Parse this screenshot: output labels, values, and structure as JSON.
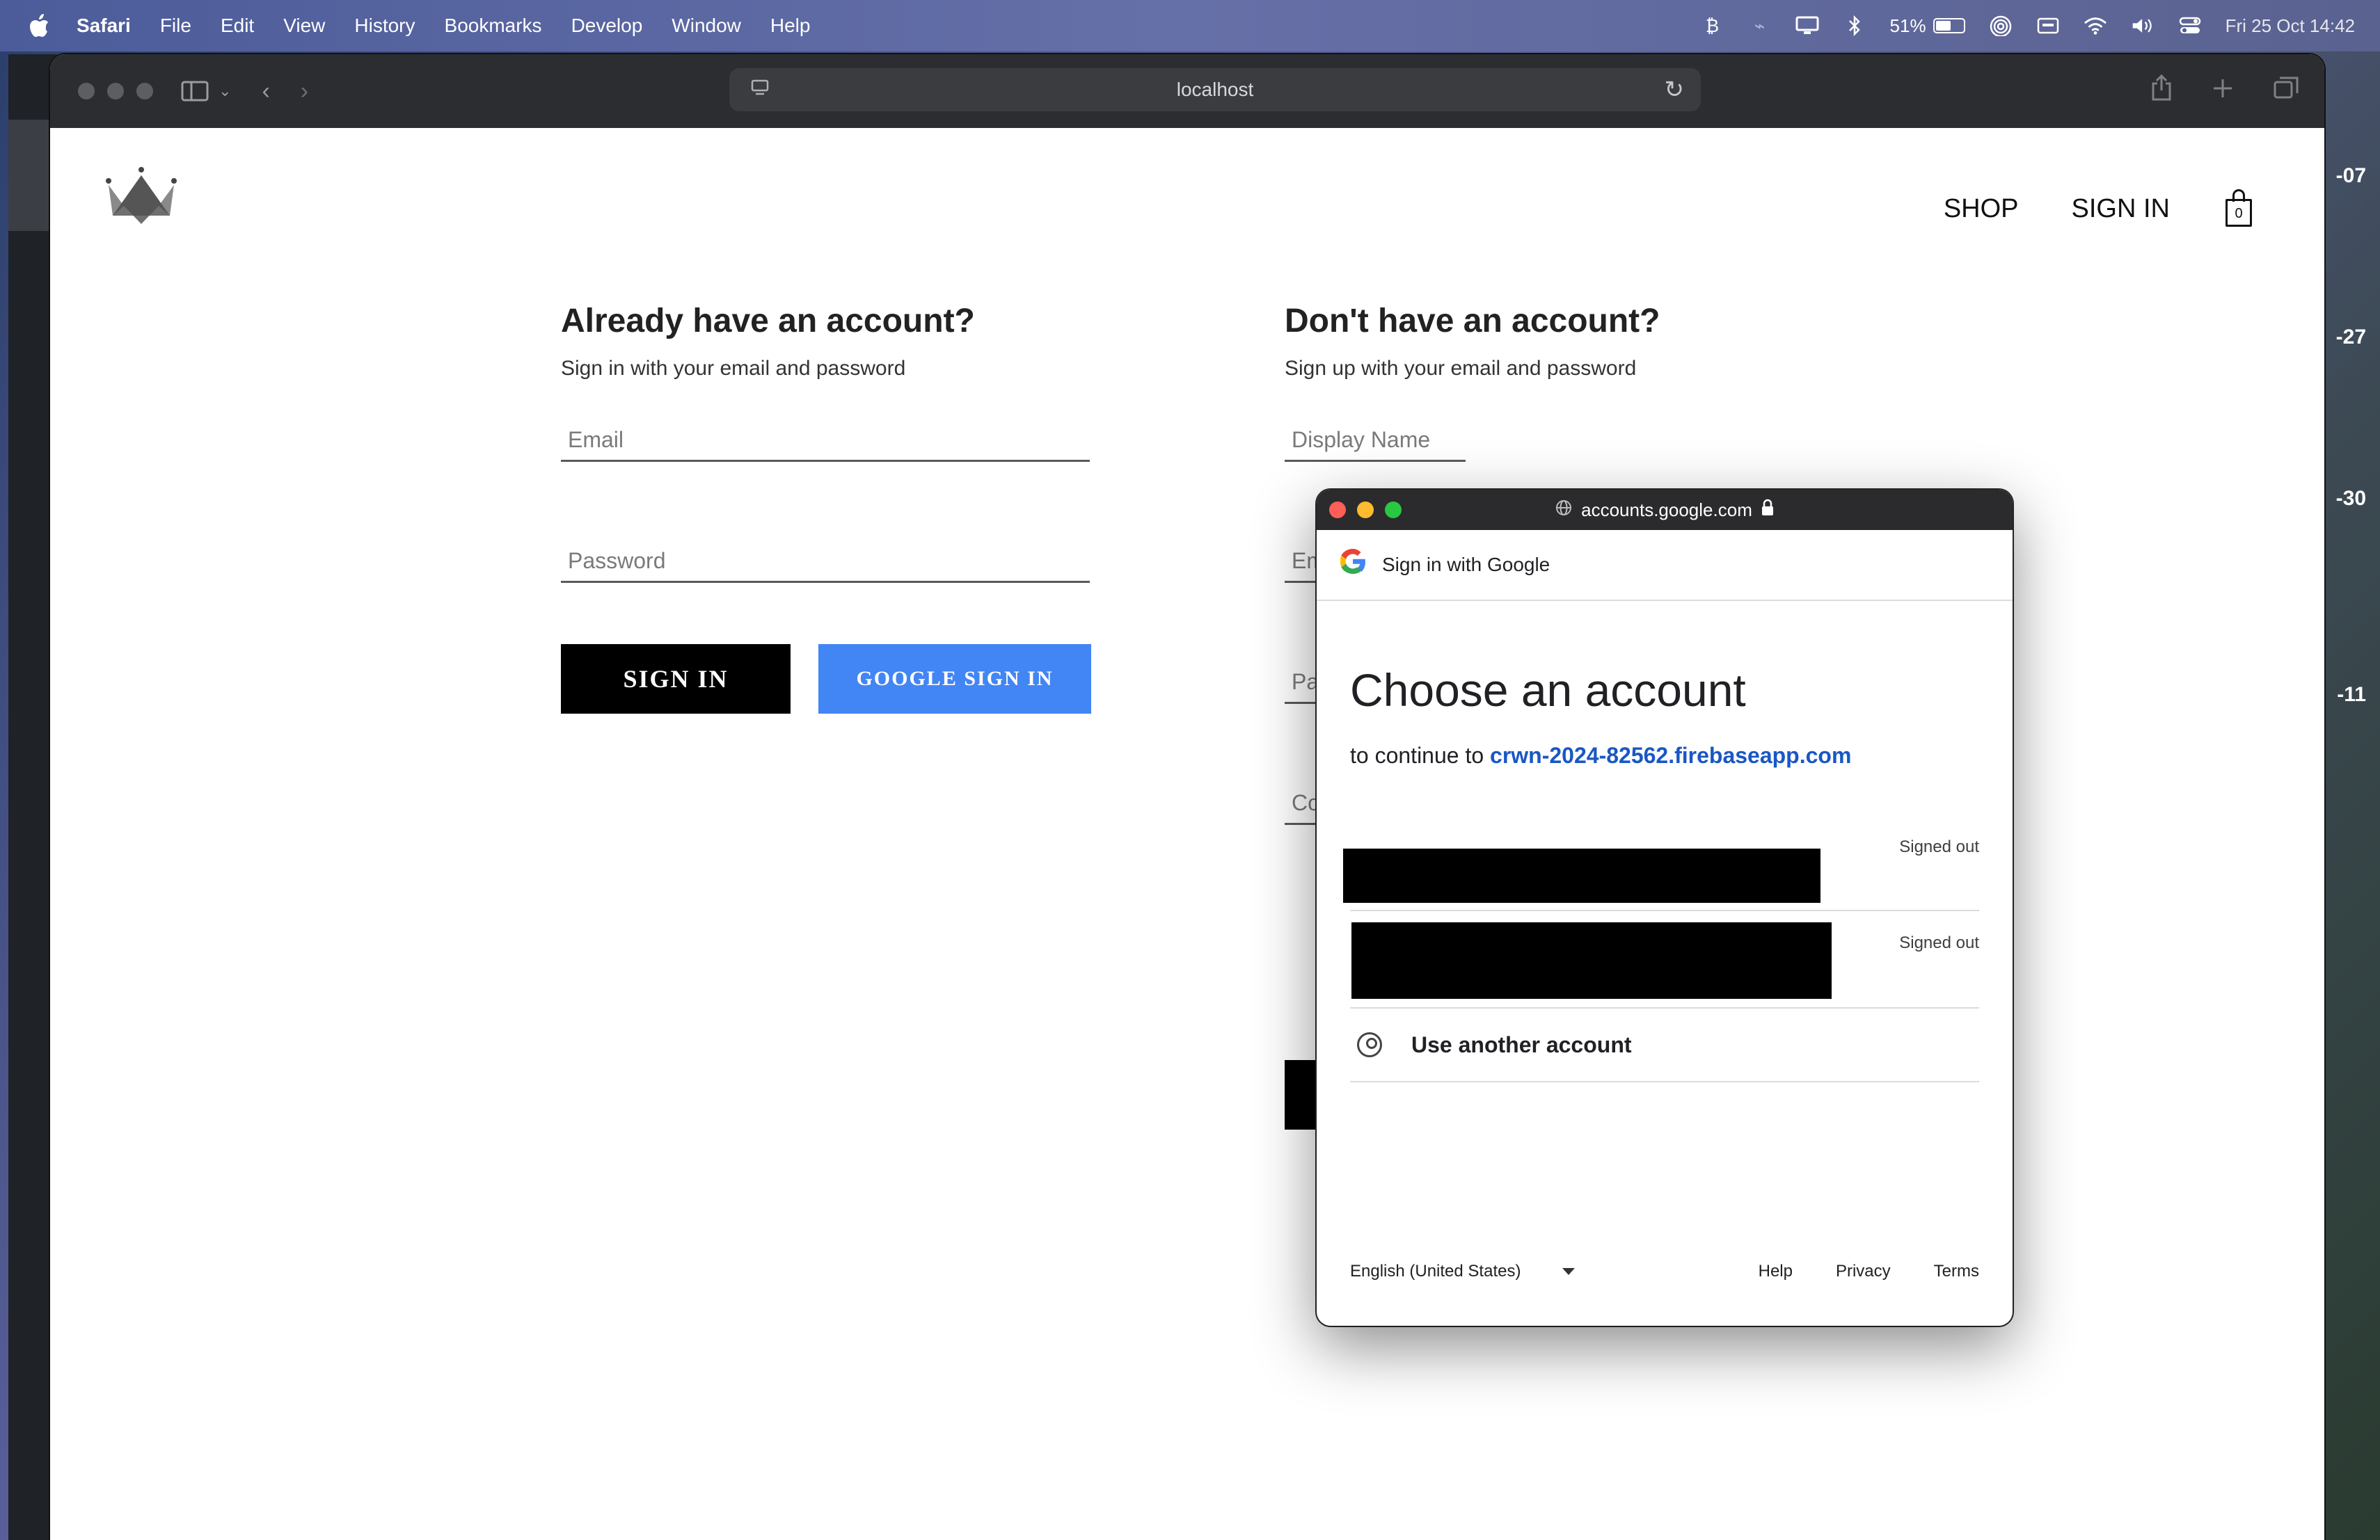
{
  "menubar": {
    "app": "Safari",
    "items": [
      "File",
      "Edit",
      "View",
      "History",
      "Bookmarks",
      "Develop",
      "Window",
      "Help"
    ],
    "battery_percent": "51%",
    "clock": "Fri 25 Oct  14:42"
  },
  "side_numbers": [
    "-07",
    "-27",
    "-30",
    "-11"
  ],
  "browser": {
    "url": "localhost"
  },
  "nav": {
    "shop": "SHOP",
    "sign_in": "SIGN IN",
    "cart_count": "0"
  },
  "signin": {
    "title": "Already have an account?",
    "subtitle": "Sign in with your email and password",
    "email_placeholder": "Email",
    "password_placeholder": "Password",
    "signin_button": "SIGN IN",
    "google_button": "GOOGLE SIGN IN"
  },
  "signup": {
    "title": "Don't have an account?",
    "subtitle": "Sign up with your email and password",
    "display_name_placeholder": "Display Name",
    "email_partial": "Em",
    "password_partial": "Pa",
    "confirm_partial": "Co"
  },
  "google_popup": {
    "titlebar_url": "accounts.google.com",
    "header": "Sign in with Google",
    "heading": "Choose an account",
    "continue_prefix": "to continue to",
    "continue_app": "crwn-2024-82562.firebaseapp.com",
    "accounts": [
      {
        "status": "Signed out"
      },
      {
        "status": "Signed out"
      }
    ],
    "use_another": "Use another account",
    "language": "English (United States)",
    "footer_links": [
      "Help",
      "Privacy",
      "Terms"
    ]
  },
  "colors": {
    "google_button": "#4285f4",
    "link_blue": "#1a57c4"
  }
}
